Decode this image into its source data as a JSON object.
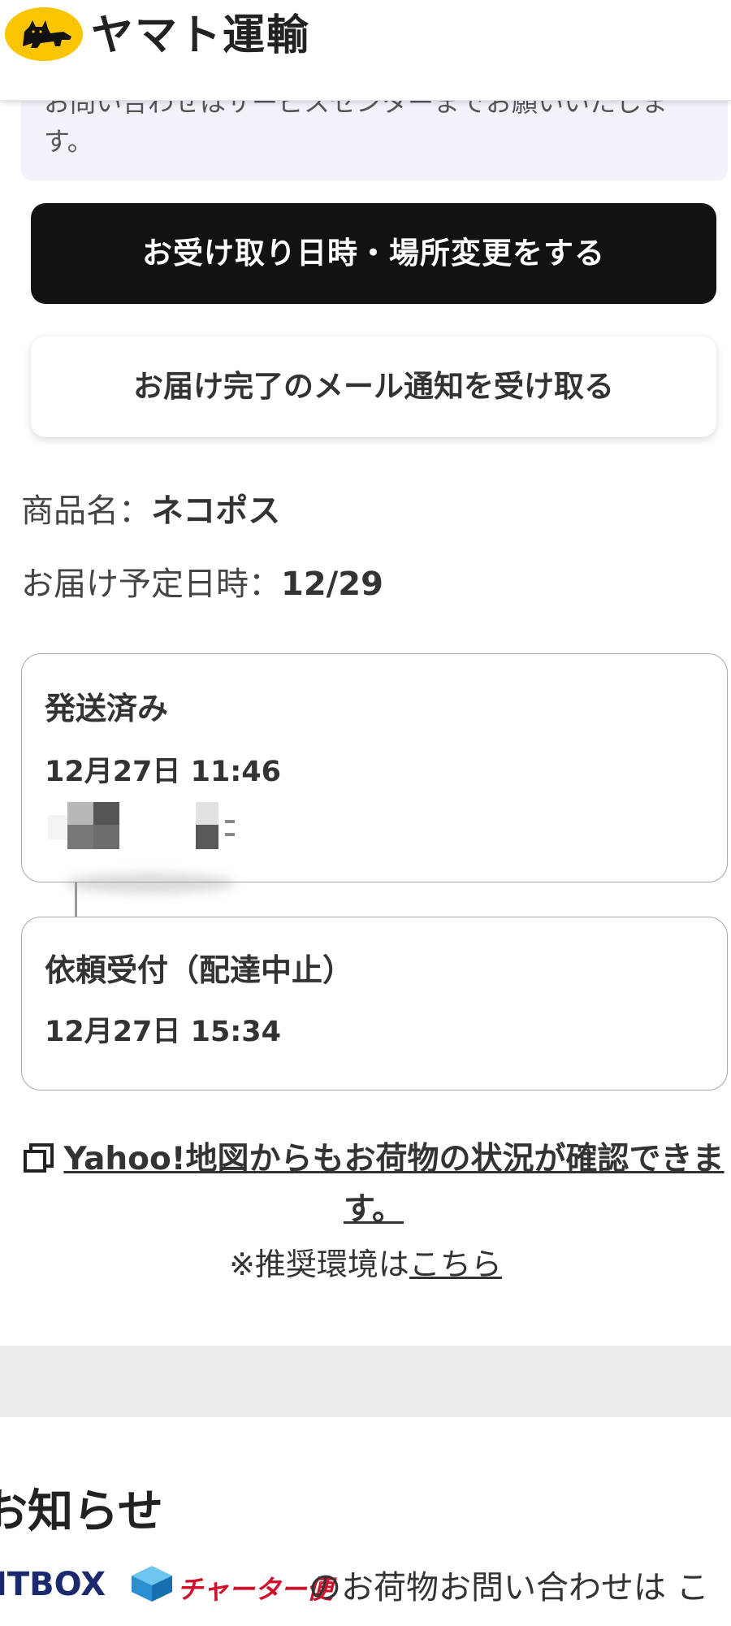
{
  "header": {
    "logo_text": "ヤマト運輸",
    "colors": {
      "logo_yellow": "#f9c400"
    }
  },
  "notice": {
    "text": "お問い合わせはサービスセンターまでお願いいたします。"
  },
  "buttons": {
    "change_label": "お受け取り日時・場所変更をする",
    "mail_label": "お届け完了のメール通知を受け取る"
  },
  "product": {
    "name_label": "商品名：",
    "name_value": "ネコポス",
    "date_label": "お届け予定日時：",
    "date_value": "12/29"
  },
  "timeline": [
    {
      "status": "発送済み",
      "datetime": "12月27日 11:46"
    },
    {
      "status": "依頼受付（配達中止）",
      "datetime": "12月27日 15:34"
    }
  ],
  "yahoo_link": {
    "text": "Yahoo!地図からもお荷物の状況が確認できます。",
    "icon": "copy-window-icon"
  },
  "recommend": {
    "prefix": "※推奨環境は",
    "link": "こちら"
  },
  "news": {
    "title": "お知らせ",
    "banner_left": "ITBOX",
    "banner_right": "チャーター便",
    "text": "のお荷物お問い合わせは こ"
  }
}
